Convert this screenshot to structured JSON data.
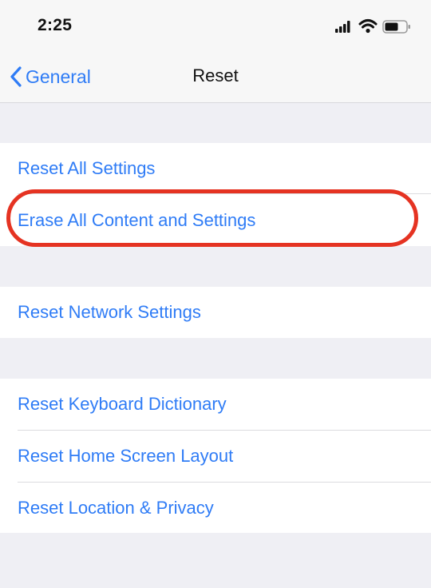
{
  "status_bar": {
    "time": "2:25",
    "icons": [
      "cellular-signal-icon",
      "wifi-icon",
      "battery-icon"
    ]
  },
  "nav": {
    "back_label": "General",
    "title": "Reset"
  },
  "groups": [
    {
      "items": [
        {
          "label": "Reset All Settings"
        },
        {
          "label": "Erase All Content and Settings",
          "highlighted": true
        }
      ]
    },
    {
      "items": [
        {
          "label": "Reset Network Settings"
        }
      ]
    },
    {
      "items": [
        {
          "label": "Reset Keyboard Dictionary"
        },
        {
          "label": "Reset Home Screen Layout"
        },
        {
          "label": "Reset Location & Privacy"
        }
      ]
    }
  ],
  "colors": {
    "accent": "#2f7cf6",
    "highlight_ring": "#e53322",
    "background": "#efeff4"
  }
}
